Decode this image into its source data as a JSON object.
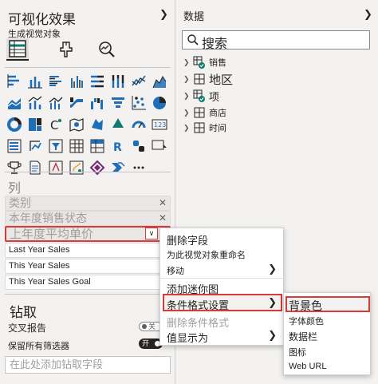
{
  "viz_pane": {
    "title": "可视化效果",
    "subtitle": "生成视觉对象",
    "collapse_icon": "chevron-right-icon",
    "build_tabs": [
      "table-build-icon",
      "format-paint-icon",
      "analytics-icon"
    ],
    "sections": {
      "columns_label": "列",
      "drill_label": "钻取"
    },
    "column_wells": [
      {
        "label": "类别",
        "style": "ghost"
      },
      {
        "label": "本年度销售状态",
        "style": "ghost"
      },
      {
        "label": "上年度平均单价",
        "style": "highlighted"
      },
      {
        "label": "Last Year Sales",
        "style": "solid"
      },
      {
        "label": "This Year Sales",
        "style": "solid"
      },
      {
        "label": "This Year Sales Goal",
        "style": "solid"
      }
    ],
    "drill": {
      "cross_report_label": "交叉报告",
      "cross_report_state": "关",
      "keep_filters_label": "保留所有筛选器",
      "keep_filters_state": "开",
      "drill_field_placeholder": "在此处添加钻取字段"
    }
  },
  "data_pane": {
    "title": "数据",
    "collapse_icon": "chevron-right-icon",
    "search_placeholder": "搜索",
    "tables": [
      {
        "label": "销售",
        "icon": "table-with-check-icon"
      },
      {
        "label": "地区",
        "icon": "table-icon"
      },
      {
        "label": "项",
        "icon": "table-with-check-icon"
      },
      {
        "label": "商店",
        "icon": "table-icon"
      },
      {
        "label": "时间",
        "icon": "table-icon"
      }
    ]
  },
  "context_menu": {
    "items": [
      {
        "label": "删除字段"
      },
      {
        "label": "为此视觉对象重命名"
      },
      {
        "label": "移动"
      },
      {
        "label": "添加迷你图"
      },
      {
        "label": "条件格式设置"
      },
      {
        "label": "删除条件格式"
      },
      {
        "label": "值显示为"
      }
    ]
  },
  "sub_menu": {
    "items": [
      {
        "label": "背景色"
      },
      {
        "label": "字体颜色"
      },
      {
        "label": "数据栏"
      },
      {
        "label": "图标"
      },
      {
        "label": "Web URL"
      }
    ]
  },
  "colors": {
    "highlight_border": "#d83b3b",
    "pane_bg": "#f3f2f1",
    "accent_teal": "#0f7b6c",
    "icon_blue": "#1e6fb8"
  }
}
